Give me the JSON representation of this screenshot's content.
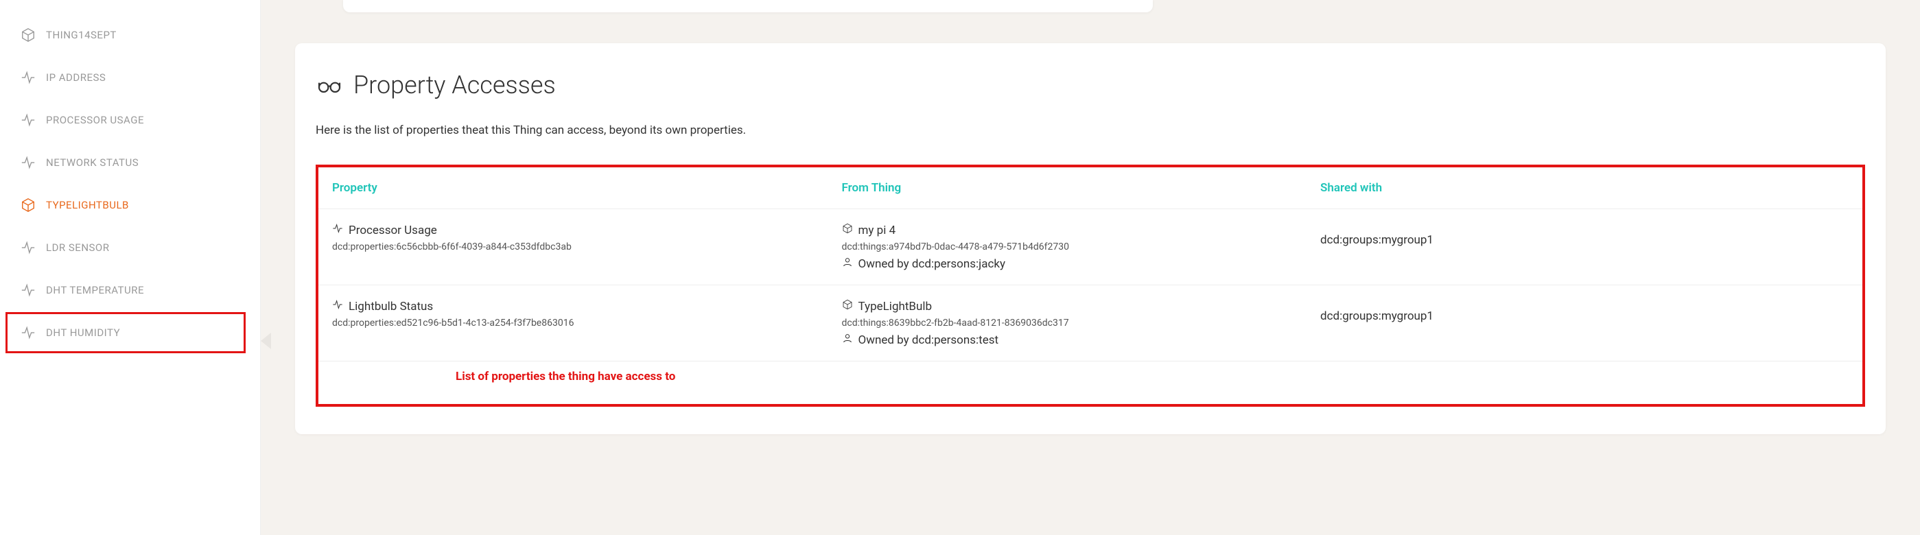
{
  "sidebar": {
    "items": [
      {
        "label": "THING14SEPT",
        "icon": "cube"
      },
      {
        "label": "IP ADDRESS",
        "icon": "activity"
      },
      {
        "label": "PROCESSOR USAGE",
        "icon": "activity"
      },
      {
        "label": "NETWORK STATUS",
        "icon": "activity"
      },
      {
        "label": "TYPELIGHTBULB",
        "icon": "cube"
      },
      {
        "label": "LDR SENSOR",
        "icon": "activity"
      },
      {
        "label": "DHT TEMPERATURE",
        "icon": "activity"
      },
      {
        "label": "DHT HUMIDITY",
        "icon": "activity"
      }
    ]
  },
  "main": {
    "title": "Property Accesses",
    "description": "Here is the list of properties theat this Thing can access, beyond its own properties.",
    "table": {
      "headers": {
        "property": "Property",
        "from": "From Thing",
        "shared": "Shared with"
      },
      "rows": [
        {
          "property_name": "Processor Usage",
          "property_id": "dcd:properties:6c56cbbb-6f6f-4039-a844-c353dfdbc3ab",
          "thing_name": "my pi 4",
          "thing_id": "dcd:things:a974bd7b-0dac-4478-a479-571b4d6f2730",
          "owned_by": "Owned by dcd:persons:jacky",
          "shared_with": "dcd:groups:mygroup1"
        },
        {
          "property_name": "Lightbulb Status",
          "property_id": "dcd:properties:ed521c96-b5d1-4c13-a254-f3f7be863016",
          "thing_name": "TypeLightBulb",
          "thing_id": "dcd:things:8639bbc2-fb2b-4aad-8121-8369036dc317",
          "owned_by": "Owned by dcd:persons:test",
          "shared_with": "dcd:groups:mygroup1"
        }
      ]
    },
    "annotation": "List of properties the thing have access to"
  }
}
